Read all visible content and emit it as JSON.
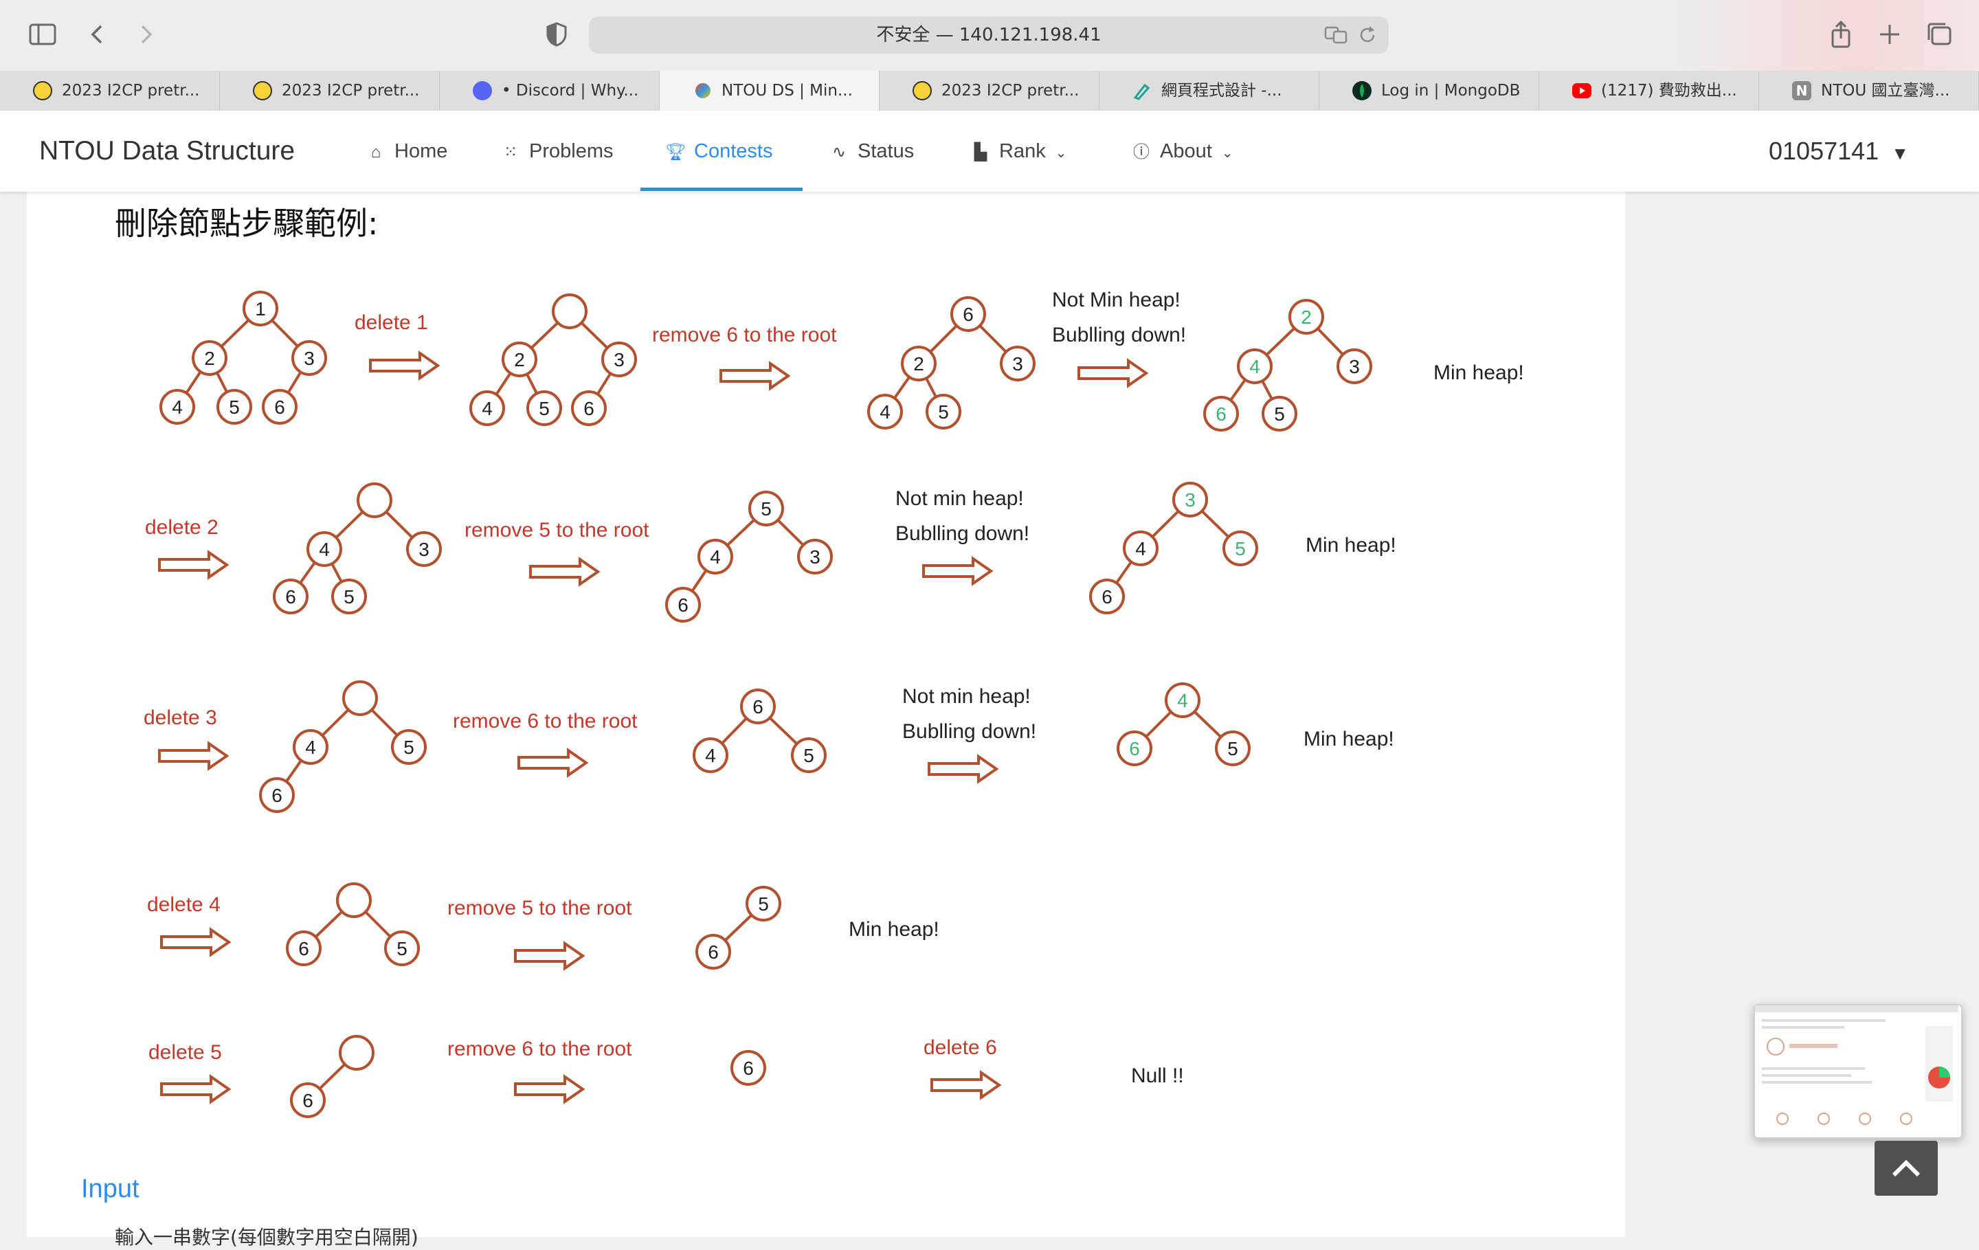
{
  "browser": {
    "url_text": "不安全 — 140.121.198.41",
    "tabs": [
      {
        "title": "2023 I2CP pretr...",
        "icon": "smiley-favicon"
      },
      {
        "title": "2023 I2CP pretr...",
        "icon": "smiley-favicon"
      },
      {
        "title": "• Discord | Why...",
        "icon": "discord-favicon"
      },
      {
        "title": "NTOU DS | Min...",
        "icon": "ntou-favicon",
        "active": true
      },
      {
        "title": "2023 I2CP pretr...",
        "icon": "smiley-favicon"
      },
      {
        "title": "網頁程式設計 -...",
        "icon": "pen-favicon"
      },
      {
        "title": "Log in | MongoDB",
        "icon": "mongodb-favicon"
      },
      {
        "title": "(1217) 費勁救出...",
        "icon": "youtube-favicon"
      },
      {
        "title": "NTOU 國立臺灣...",
        "icon": "notion-favicon"
      }
    ]
  },
  "site": {
    "brand": "NTOU Data Structure",
    "nav": [
      {
        "label": "Home",
        "icon": "home-icon"
      },
      {
        "label": "Problems",
        "icon": "grid-icon"
      },
      {
        "label": "Contests",
        "icon": "trophy-icon",
        "active": true
      },
      {
        "label": "Status",
        "icon": "pulse-icon"
      },
      {
        "label": "Rank",
        "icon": "bar-chart-icon",
        "dropdown": true
      },
      {
        "label": "About",
        "icon": "info-icon",
        "dropdown": true
      }
    ],
    "user": "01057141"
  },
  "content": {
    "heading": "刪除節點步驟範例:",
    "input_heading": "Input",
    "input_desc": "輸入一串數字(每個數字用空白隔開)"
  },
  "diagram": {
    "colors": {
      "node": "#b0522f",
      "label_red": "#c0392b",
      "green": "#3cb371",
      "text": "#222222"
    },
    "labels": {
      "delete_1": "delete   1",
      "remove_6": "remove  6 to the root",
      "not_min": "Not Min heap!",
      "bubble": "Bublling down!",
      "min_heap": "Min heap!",
      "delete_2": "delete   2",
      "remove_5": "remove   5   to the root",
      "not_min_lc": "Not   min heap!",
      "delete_3": "delete  3",
      "remove_6b": "remove   6   to the root",
      "delete_4": "delete   4",
      "remove_5b": "remove  5 to the root",
      "delete_5": "delete   5",
      "remove_6c": "remove  6 to the root",
      "delete_6": "delete   6",
      "null": "Null !!"
    },
    "node_values": [
      "1",
      "2",
      "3",
      "4",
      "5",
      "6"
    ]
  }
}
